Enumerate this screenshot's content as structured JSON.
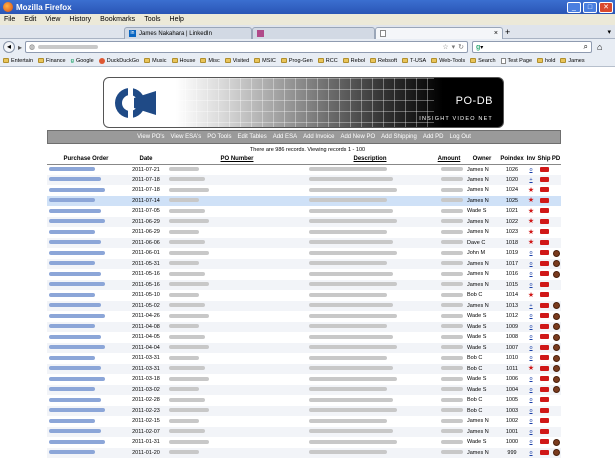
{
  "window": {
    "title": "Mozilla Firefox"
  },
  "menu": [
    "File",
    "Edit",
    "View",
    "History",
    "Bookmarks",
    "Tools",
    "Help"
  ],
  "tabs": [
    {
      "label": "James Nakahara | LinkedIn"
    },
    {
      "label": ""
    },
    {
      "label": ""
    }
  ],
  "bookmarks": [
    "Entertain",
    "Finance",
    "Google",
    "DuckDuckGo",
    "Music",
    "House",
    "Misc",
    "Visited",
    "MSIC",
    "Prog-Gen",
    "RCC",
    "Rebol",
    "Rebsoft",
    "T-USA",
    "Web-Tools",
    "Search",
    "Test Page",
    "hold",
    "James"
  ],
  "banner": {
    "brand": "PO-DB",
    "tagline": "INSIGHT VIDEO NET"
  },
  "nav": [
    "View PO's",
    "View ESA's",
    "PO Tools",
    "Edit Tables",
    "Add ESA",
    "Add Invoice",
    "Add New PO",
    "Add Shipping",
    "Add PD",
    "Log Out"
  ],
  "records_text": "There are 986 records. Viewing records 1 - 100",
  "columns": {
    "purchase_order": "Purchase Order",
    "date": "Date",
    "po_number": "PO Number",
    "description": "Description",
    "amount": "Amount",
    "owner": "Owner",
    "poindex": "Poindex",
    "inv": "Inv",
    "ship": "Ship",
    "pd": "PD"
  },
  "rows": [
    {
      "date": "2011-07-21",
      "owner": "James N",
      "poindex": "1026",
      "inv": "o",
      "ship": true,
      "pd": false
    },
    {
      "date": "2011-07-18",
      "owner": "James N",
      "poindex": "1020",
      "inv": "+",
      "ship": true,
      "pd": false
    },
    {
      "date": "2011-07-18",
      "owner": "James N",
      "poindex": "1024",
      "inv": "star",
      "ship": true,
      "pd": false
    },
    {
      "date": "2011-07-14",
      "owner": "James N",
      "poindex": "1025",
      "inv": "star",
      "ship": true,
      "pd": false,
      "highlight": true
    },
    {
      "date": "2011-07-05",
      "owner": "Wade S",
      "poindex": "1021",
      "inv": "star",
      "ship": true,
      "pd": false
    },
    {
      "date": "2011-06-29",
      "owner": "James N",
      "poindex": "1022",
      "inv": "star",
      "ship": true,
      "pd": false
    },
    {
      "date": "2011-06-29",
      "owner": "James N",
      "poindex": "1023",
      "inv": "star",
      "ship": true,
      "pd": false
    },
    {
      "date": "2011-06-06",
      "owner": "Dave C",
      "poindex": "1018",
      "inv": "star",
      "ship": true,
      "pd": false
    },
    {
      "date": "2011-06-01",
      "owner": "John M",
      "poindex": "1019",
      "inv": "o",
      "ship": true,
      "pd": true
    },
    {
      "date": "2011-05-31",
      "owner": "James N",
      "poindex": "1017",
      "inv": "o",
      "ship": true,
      "pd": true
    },
    {
      "date": "2011-05-16",
      "owner": "James N",
      "poindex": "1016",
      "inv": "o",
      "ship": true,
      "pd": true
    },
    {
      "date": "2011-05-16",
      "owner": "James N",
      "poindex": "1015",
      "inv": "o",
      "ship": true,
      "pd": false
    },
    {
      "date": "2011-05-10",
      "owner": "Bob C",
      "poindex": "1014",
      "inv": "star",
      "ship": true,
      "pd": false
    },
    {
      "date": "2011-05-02",
      "owner": "James N",
      "poindex": "1013",
      "inv": "+",
      "ship": true,
      "pd": true
    },
    {
      "date": "2011-04-26",
      "owner": "Wade S",
      "poindex": "1012",
      "inv": "o",
      "ship": true,
      "pd": true
    },
    {
      "date": "2011-04-08",
      "owner": "Wade S",
      "poindex": "1009",
      "inv": "o",
      "ship": true,
      "pd": true
    },
    {
      "date": "2011-04-05",
      "owner": "Wade S",
      "poindex": "1008",
      "inv": "o",
      "ship": true,
      "pd": true
    },
    {
      "date": "2011-04-04",
      "owner": "Wade S",
      "poindex": "1007",
      "inv": "o",
      "ship": true,
      "pd": true
    },
    {
      "date": "2011-03-31",
      "owner": "Bob C",
      "poindex": "1010",
      "inv": "o",
      "ship": true,
      "pd": true
    },
    {
      "date": "2011-03-31",
      "owner": "Bob C",
      "poindex": "1011",
      "inv": "star",
      "ship": true,
      "pd": true
    },
    {
      "date": "2011-03-18",
      "owner": "Wade S",
      "poindex": "1006",
      "inv": "o",
      "ship": true,
      "pd": true
    },
    {
      "date": "2011-03-02",
      "owner": "Wade S",
      "poindex": "1004",
      "inv": "o",
      "ship": true,
      "pd": true
    },
    {
      "date": "2011-02-28",
      "owner": "Bob C",
      "poindex": "1005",
      "inv": "o",
      "ship": true,
      "pd": false
    },
    {
      "date": "2011-02-23",
      "owner": "Bob C",
      "poindex": "1003",
      "inv": "o",
      "ship": true,
      "pd": false
    },
    {
      "date": "2011-02-15",
      "owner": "James N",
      "poindex": "1002",
      "inv": "o",
      "ship": true,
      "pd": false
    },
    {
      "date": "2011-02-07",
      "owner": "James N",
      "poindex": "1001",
      "inv": "o",
      "ship": true,
      "pd": false
    },
    {
      "date": "2011-01-31",
      "owner": "Wade S",
      "poindex": "1000",
      "inv": "o",
      "ship": true,
      "pd": true
    },
    {
      "date": "2011-01-20",
      "owner": "James N",
      "poindex": "999",
      "inv": "o",
      "ship": true,
      "pd": true
    }
  ],
  "colors": {
    "accent_red": "#d01818",
    "link_blue": "#1a3fa8",
    "nav_gray": "#9a9a9a",
    "titlebar_blue": "#2a55b5"
  }
}
